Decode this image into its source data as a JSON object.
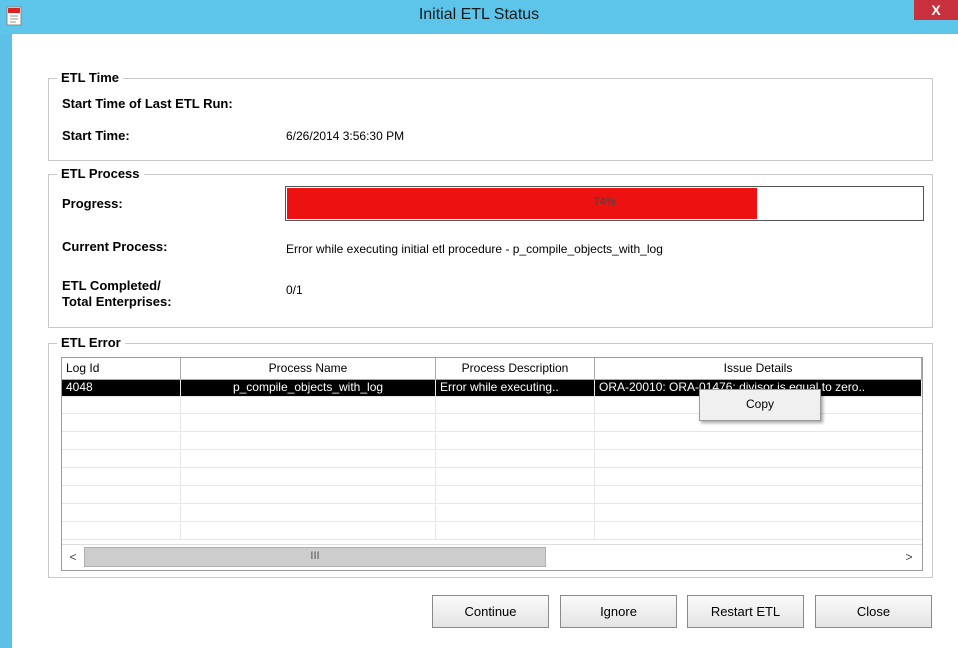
{
  "window": {
    "title": "Initial ETL Status",
    "close_label": "X"
  },
  "etl_time": {
    "legend": "ETL Time",
    "last_run_label": "Start Time of Last ETL Run:",
    "start_label": "Start Time:",
    "start_value": "6/26/2014 3:56:30 PM"
  },
  "etl_process": {
    "legend": "ETL Process",
    "progress_label": "Progress:",
    "progress_percent": 74,
    "progress_text": "74%",
    "current_label": "Current Process:",
    "current_value": "Error while executing initial etl procedure - p_compile_objects_with_log",
    "completed_label_1": "ETL Completed/",
    "completed_label_2": "Total Enterprises:",
    "completed_value": "0/1"
  },
  "etl_error": {
    "legend": "ETL Error",
    "columns": [
      "Log Id",
      "Process Name",
      "Process Description",
      "Issue Details"
    ],
    "rows": [
      {
        "log_id": "4048",
        "process_name": "p_compile_objects_with_log",
        "process_description": "Error while executing..",
        "issue_details": "ORA-20010: ORA-01476: divisor is equal to zero.."
      }
    ],
    "scroll_left": "<",
    "scroll_right": ">",
    "scroll_grip": "III"
  },
  "context_menu": {
    "copy_label": "Copy"
  },
  "buttons": {
    "continue": "Continue",
    "ignore": "Ignore",
    "restart": "Restart ETL",
    "close": "Close"
  },
  "colors": {
    "titlebar": "#5dc4ea",
    "progress_fill": "#ee1111",
    "close_button": "#c7303c"
  }
}
